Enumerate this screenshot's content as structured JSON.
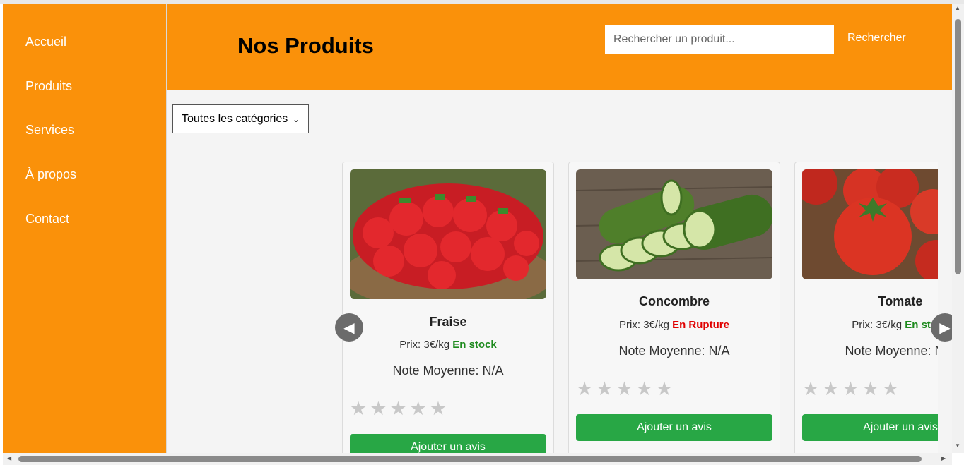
{
  "nav": {
    "items": [
      "Accueil",
      "Produits",
      "Services",
      "À propos",
      "Contact"
    ]
  },
  "header": {
    "title": "Nos Produits",
    "search_placeholder": "Rechercher un produit...",
    "search_button": "Rechercher"
  },
  "filter": {
    "selected": "Toutes les catégories"
  },
  "carousel": {
    "prev_icon": "chevron-left-icon",
    "next_icon": "chevron-right-icon",
    "products": [
      {
        "name": "Fraise",
        "price_label": "Prix: 3€/kg",
        "stock": "En stock",
        "rating": "Note Moyenne: N/A",
        "button": "Ajouter un avis",
        "image": "strawberries"
      },
      {
        "name": "Concombre",
        "price_label": "Prix: 3€/kg",
        "stock": "En Rupture",
        "rating": "Note Moyenne: N/A",
        "button": "Ajouter un avis",
        "image": "cucumbers"
      },
      {
        "name": "Tomate",
        "price_label": "Prix: 3€/kg",
        "stock": "En stock",
        "rating": "Note Moyenne: N/A",
        "button": "Ajouter un avis",
        "image": "tomatoes"
      }
    ],
    "stars": "★★★★★"
  },
  "colors": {
    "brand_orange": "#fa910a",
    "button_green": "#28a745",
    "in_stock": "#1d8a1d",
    "out_of_stock": "#e00000"
  }
}
